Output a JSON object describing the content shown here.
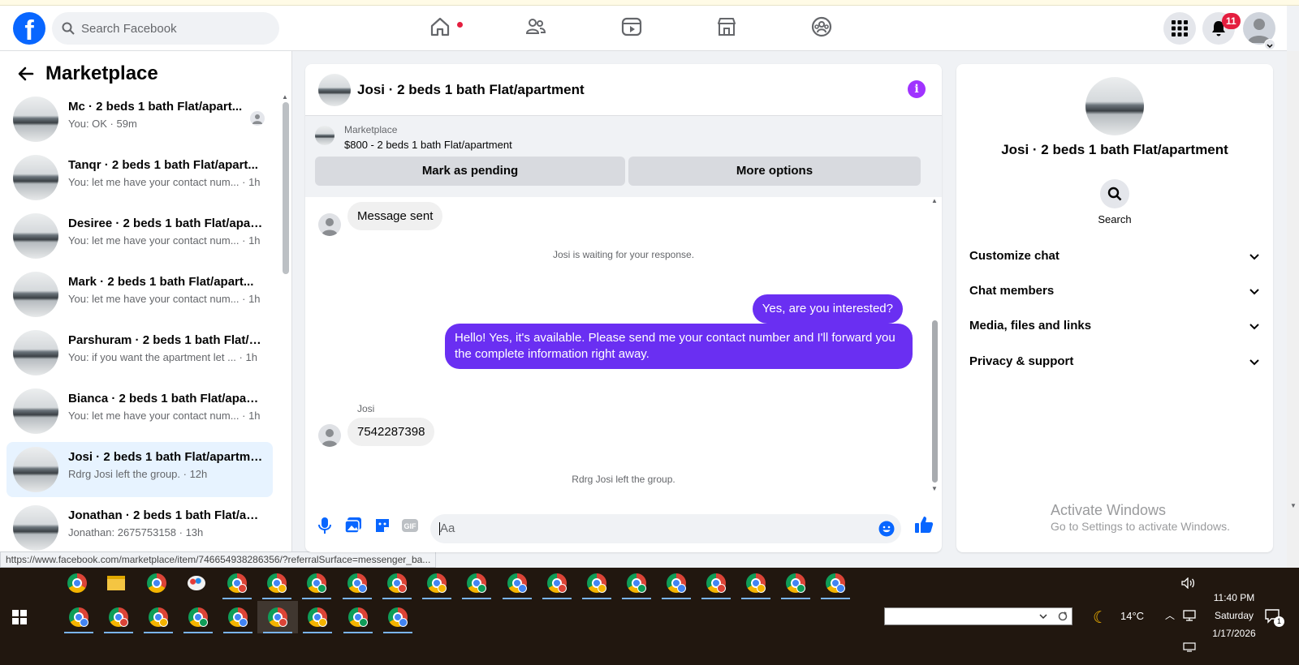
{
  "browser": {
    "status_url": "https://www.facebook.com/marketplace/item/746654938286356/?referralSurface=messenger_ba..."
  },
  "topbar": {
    "logo": "f",
    "search_placeholder": "Search Facebook",
    "notif_count": "11",
    "nav_icons": [
      "home-icon",
      "friends-icon",
      "video-icon",
      "marketplace-icon",
      "groups-icon"
    ]
  },
  "sidebar": {
    "title": "Marketplace",
    "conversations": [
      {
        "title": "Mc · 2 beds 1 bath Flat/apart...",
        "preview": "You: OK · 59m"
      },
      {
        "title": "Tanqr · 2 beds 1 bath Flat/apart...",
        "preview": "You: let me have your contact num... · 1h"
      },
      {
        "title": "Desiree · 2 beds 1 bath Flat/apar...",
        "preview": "You: let me have your contact num... · 1h"
      },
      {
        "title": "Mark · 2 beds 1 bath Flat/apart...",
        "preview": "You: let me have your contact num... · 1h"
      },
      {
        "title": "Parshuram · 2 beds 1 bath Flat/a...",
        "preview": "You: if you want the apartment let ... · 1h"
      },
      {
        "title": "Bianca · 2 beds 1 bath Flat/apart...",
        "preview": "You: let me have your contact num... · 1h"
      },
      {
        "title": "Josi · 2 beds 1 bath Flat/apartme...",
        "preview": "Rdrg Josi left the group. · 12h"
      },
      {
        "title": "Jonathan · 2 beds 1 bath Flat/ap...",
        "preview": "Jonathan: 2675753158 · 13h"
      }
    ]
  },
  "chat": {
    "title": "Josi · 2 beds 1 bath Flat/apartment",
    "marketplace_label": "Marketplace",
    "listing": "$800 - 2 beds 1 bath Flat/apartment",
    "btn_pending": "Mark as pending",
    "btn_more": "More options",
    "msg_sent": "Message sent",
    "waiting": "Josi is waiting for your response.",
    "out1": "Yes, are you interested?",
    "out2": "Hello! Yes, it's available. Please send me your contact number and I'll forward you the complete information right away.",
    "sender": "Josi",
    "in_number": "7542287398",
    "left_group": "Rdrg Josi left the group.",
    "composer_placeholder": "Aa",
    "gif_label": "GIF"
  },
  "details": {
    "title": "Josi · 2 beds 1 bath Flat/apartment",
    "search_label": "Search",
    "sections": [
      "Customize chat",
      "Chat members",
      "Media, files and links",
      "Privacy & support"
    ]
  },
  "watermark": {
    "line1": "Activate Windows",
    "line2": "Go to Settings to activate Windows."
  },
  "taskbar": {
    "temperature": "14°C",
    "time": "11:40 PM",
    "day": "Saturday",
    "date": "1/17/2026",
    "chat_badge": "1"
  },
  "colors": {
    "brand": "#0866ff",
    "bubble_out": "#6a2ff2",
    "accent_info": "#a033ff"
  }
}
